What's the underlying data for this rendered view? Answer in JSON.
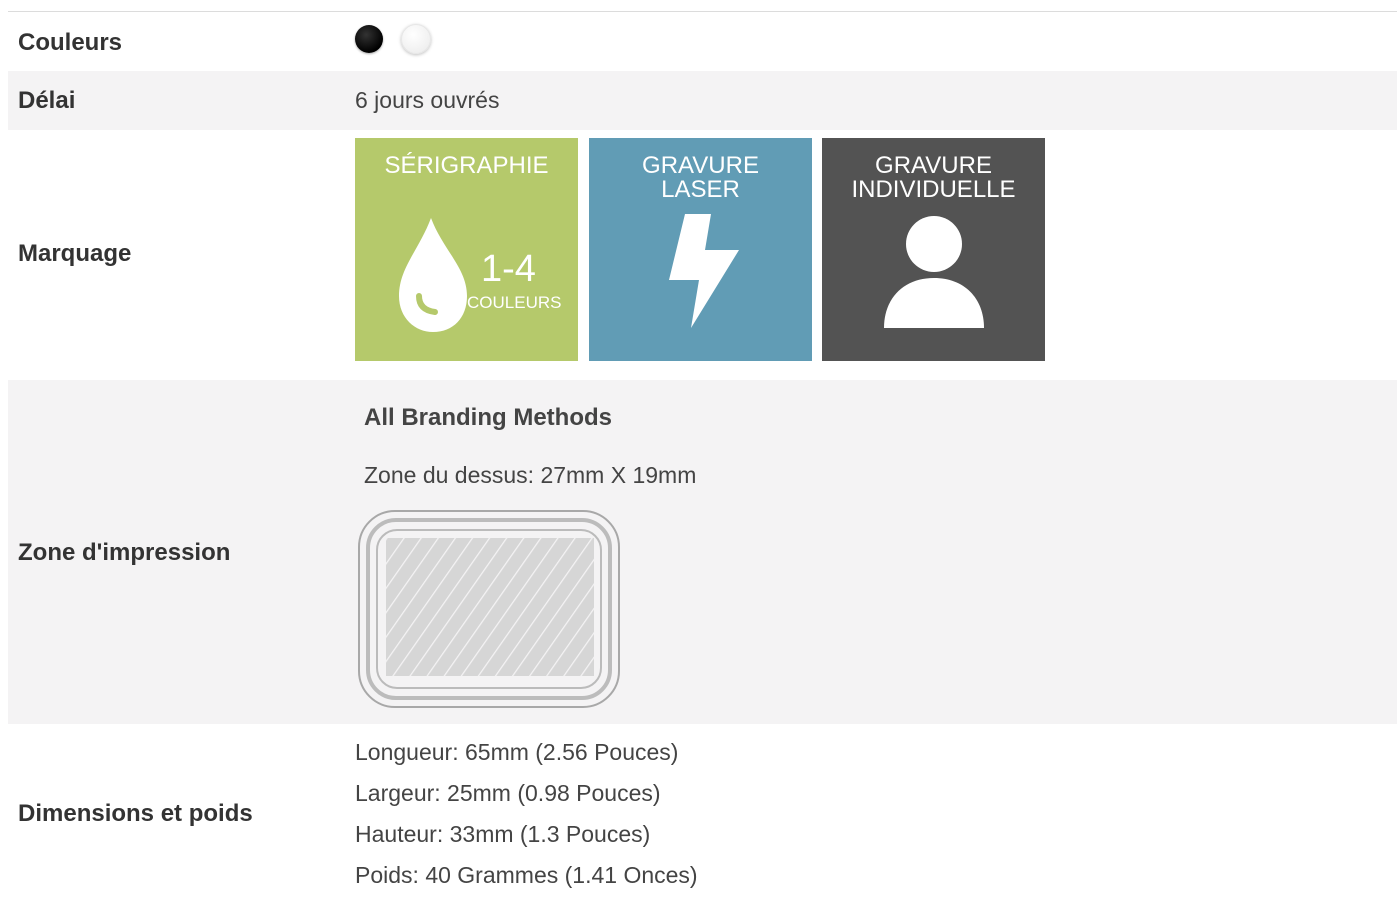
{
  "rows": {
    "colors": {
      "label": "Couleurs",
      "swatches": [
        {
          "name": "black",
          "color": "#000000"
        },
        {
          "name": "white",
          "color": "#ffffff"
        }
      ]
    },
    "lead_time": {
      "label": "Délai",
      "value": "6 jours ouvrés"
    },
    "marking": {
      "label": "Marquage",
      "methods": [
        {
          "title": "SÉRIGRAPHIE",
          "icon": "ink-drop-icon",
          "range": "1-4",
          "unit": "COULEURS",
          "color": "#b5c96b"
        },
        {
          "title": "GRAVURE\nLASER",
          "icon": "lightning-icon",
          "color": "#619cb5"
        },
        {
          "title": "GRAVURE\nINDIVIDUELLE",
          "icon": "user-icon",
          "color": "#535353"
        }
      ]
    },
    "print_area": {
      "label": "Zone d'impression",
      "heading": "All Branding Methods",
      "area": "Zone du dessus: 27mm X 19mm",
      "diagram_icon": "print-area-diagram-icon"
    },
    "dimensions": {
      "label": "Dimensions et poids",
      "lines": [
        "Longueur: 65mm (2.56 Pouces)",
        "Largeur: 25mm (0.98 Pouces)",
        "Hauteur: 33mm (1.3 Pouces)",
        "Poids: 40 Grammes (1.41 Onces)"
      ]
    }
  }
}
